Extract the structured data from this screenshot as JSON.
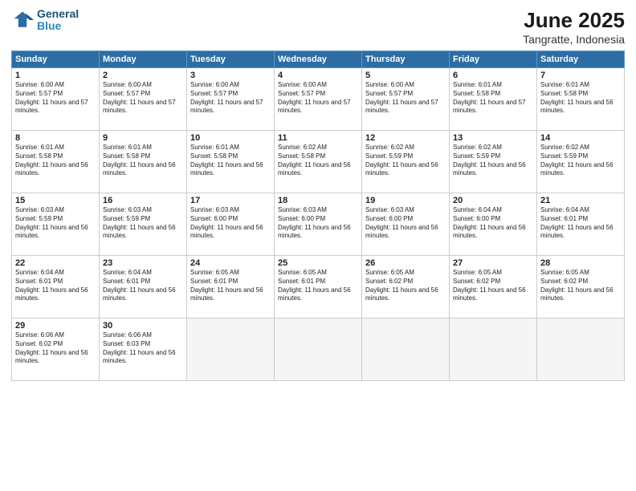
{
  "header": {
    "logo_line1": "General",
    "logo_line2": "Blue",
    "month": "June 2025",
    "location": "Tangratte, Indonesia"
  },
  "weekdays": [
    "Sunday",
    "Monday",
    "Tuesday",
    "Wednesday",
    "Thursday",
    "Friday",
    "Saturday"
  ],
  "weeks": [
    [
      {
        "day": 1,
        "sunrise": "6:00 AM",
        "sunset": "5:57 PM",
        "daylight": "11 hours and 57 minutes."
      },
      {
        "day": 2,
        "sunrise": "6:00 AM",
        "sunset": "5:57 PM",
        "daylight": "11 hours and 57 minutes."
      },
      {
        "day": 3,
        "sunrise": "6:00 AM",
        "sunset": "5:57 PM",
        "daylight": "11 hours and 57 minutes."
      },
      {
        "day": 4,
        "sunrise": "6:00 AM",
        "sunset": "5:57 PM",
        "daylight": "11 hours and 57 minutes."
      },
      {
        "day": 5,
        "sunrise": "6:00 AM",
        "sunset": "5:57 PM",
        "daylight": "11 hours and 57 minutes."
      },
      {
        "day": 6,
        "sunrise": "6:01 AM",
        "sunset": "5:58 PM",
        "daylight": "11 hours and 57 minutes."
      },
      {
        "day": 7,
        "sunrise": "6:01 AM",
        "sunset": "5:58 PM",
        "daylight": "11 hours and 56 minutes."
      }
    ],
    [
      {
        "day": 8,
        "sunrise": "6:01 AM",
        "sunset": "5:58 PM",
        "daylight": "11 hours and 56 minutes."
      },
      {
        "day": 9,
        "sunrise": "6:01 AM",
        "sunset": "5:58 PM",
        "daylight": "11 hours and 56 minutes."
      },
      {
        "day": 10,
        "sunrise": "6:01 AM",
        "sunset": "5:58 PM",
        "daylight": "11 hours and 56 minutes."
      },
      {
        "day": 11,
        "sunrise": "6:02 AM",
        "sunset": "5:58 PM",
        "daylight": "11 hours and 56 minutes."
      },
      {
        "day": 12,
        "sunrise": "6:02 AM",
        "sunset": "5:59 PM",
        "daylight": "11 hours and 56 minutes."
      },
      {
        "day": 13,
        "sunrise": "6:02 AM",
        "sunset": "5:59 PM",
        "daylight": "11 hours and 56 minutes."
      },
      {
        "day": 14,
        "sunrise": "6:02 AM",
        "sunset": "5:59 PM",
        "daylight": "11 hours and 56 minutes."
      }
    ],
    [
      {
        "day": 15,
        "sunrise": "6:03 AM",
        "sunset": "5:59 PM",
        "daylight": "11 hours and 56 minutes."
      },
      {
        "day": 16,
        "sunrise": "6:03 AM",
        "sunset": "5:59 PM",
        "daylight": "11 hours and 56 minutes."
      },
      {
        "day": 17,
        "sunrise": "6:03 AM",
        "sunset": "6:00 PM",
        "daylight": "11 hours and 56 minutes."
      },
      {
        "day": 18,
        "sunrise": "6:03 AM",
        "sunset": "6:00 PM",
        "daylight": "11 hours and 56 minutes."
      },
      {
        "day": 19,
        "sunrise": "6:03 AM",
        "sunset": "6:00 PM",
        "daylight": "11 hours and 56 minutes."
      },
      {
        "day": 20,
        "sunrise": "6:04 AM",
        "sunset": "6:00 PM",
        "daylight": "11 hours and 56 minutes."
      },
      {
        "day": 21,
        "sunrise": "6:04 AM",
        "sunset": "6:01 PM",
        "daylight": "11 hours and 56 minutes."
      }
    ],
    [
      {
        "day": 22,
        "sunrise": "6:04 AM",
        "sunset": "6:01 PM",
        "daylight": "11 hours and 56 minutes."
      },
      {
        "day": 23,
        "sunrise": "6:04 AM",
        "sunset": "6:01 PM",
        "daylight": "11 hours and 56 minutes."
      },
      {
        "day": 24,
        "sunrise": "6:05 AM",
        "sunset": "6:01 PM",
        "daylight": "11 hours and 56 minutes."
      },
      {
        "day": 25,
        "sunrise": "6:05 AM",
        "sunset": "6:01 PM",
        "daylight": "11 hours and 56 minutes."
      },
      {
        "day": 26,
        "sunrise": "6:05 AM",
        "sunset": "6:02 PM",
        "daylight": "11 hours and 56 minutes."
      },
      {
        "day": 27,
        "sunrise": "6:05 AM",
        "sunset": "6:02 PM",
        "daylight": "11 hours and 56 minutes."
      },
      {
        "day": 28,
        "sunrise": "6:05 AM",
        "sunset": "6:02 PM",
        "daylight": "11 hours and 56 minutes."
      }
    ],
    [
      {
        "day": 29,
        "sunrise": "6:06 AM",
        "sunset": "6:02 PM",
        "daylight": "11 hours and 56 minutes."
      },
      {
        "day": 30,
        "sunrise": "6:06 AM",
        "sunset": "6:03 PM",
        "daylight": "11 hours and 56 minutes."
      },
      null,
      null,
      null,
      null,
      null
    ]
  ]
}
